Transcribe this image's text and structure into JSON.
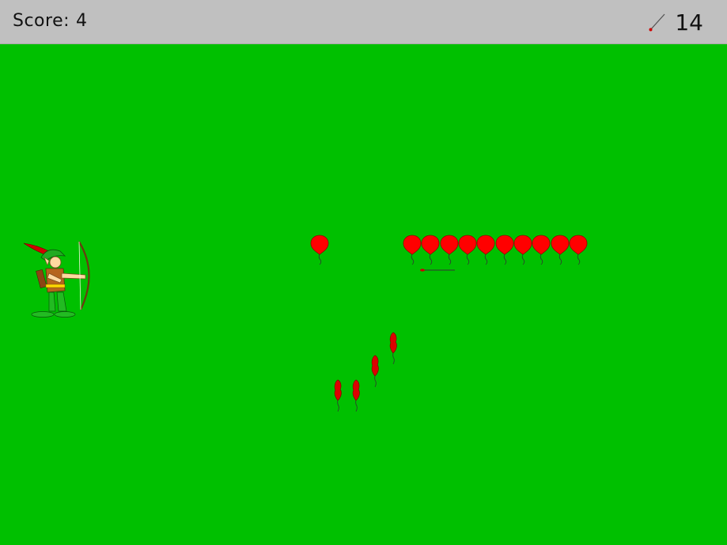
{
  "hud": {
    "score_label": "Score:",
    "score_value": "4",
    "arrows_icon": "arrow-icon",
    "arrows_left": "14"
  },
  "colors": {
    "field": "#00c000",
    "hud_bar": "#c0c0c0",
    "balloon": "#ff0000",
    "popped_balloon": "#dd0000",
    "arrow_tip": "#cc0000"
  },
  "game": {
    "row_balloons_intact": 11,
    "popped_balloons_falling": 4,
    "arrow_in_flight": true
  }
}
